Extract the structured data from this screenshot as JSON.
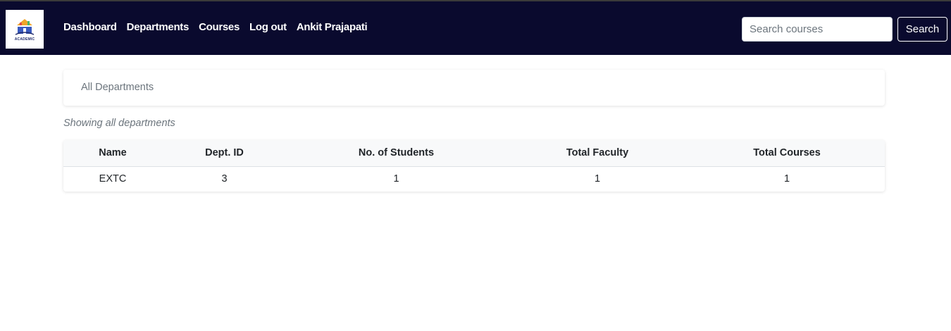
{
  "header": {
    "logo_text": "ACADEMIC",
    "nav": [
      {
        "label": "Dashboard"
      },
      {
        "label": "Departments"
      },
      {
        "label": "Courses"
      },
      {
        "label": "Log out"
      },
      {
        "label": "Ankit Prajapati"
      }
    ],
    "search": {
      "placeholder": "Search courses",
      "value": "",
      "button_label": "Search"
    }
  },
  "breadcrumb": {
    "label": "All Departments"
  },
  "subtitle": "Showing all departments",
  "table": {
    "columns": [
      "Name",
      "Dept. ID",
      "No. of Students",
      "Total Faculty",
      "Total Courses"
    ],
    "rows": [
      [
        "EXTC",
        "3",
        "1",
        "1",
        "1"
      ]
    ]
  },
  "colors": {
    "navbar": "#0a0a2e",
    "accent": "#1f2a6b"
  }
}
